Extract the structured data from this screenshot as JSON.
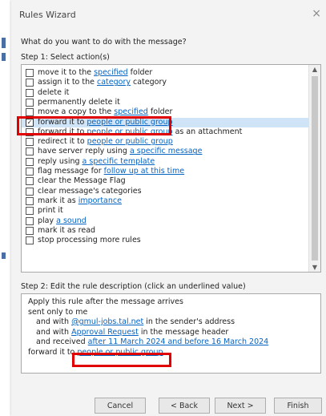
{
  "dialog": {
    "title": "Rules Wizard",
    "close_glyph": "×",
    "question": "What do you want to do with the message?",
    "step1_label": "Step 1: Select action(s)",
    "step2_label": "Step 2: Edit the rule description (click an underlined value)"
  },
  "actions": [
    {
      "checked": false,
      "before": "move it to the ",
      "link": "specified",
      "after": " folder"
    },
    {
      "checked": false,
      "before": "assign it to the ",
      "link": "category",
      "after": " category"
    },
    {
      "checked": false,
      "before": "delete it",
      "link": "",
      "after": ""
    },
    {
      "checked": false,
      "before": "permanently delete it",
      "link": "",
      "after": ""
    },
    {
      "checked": false,
      "before": "move a copy to the ",
      "link": "specified",
      "after": " folder"
    },
    {
      "checked": true,
      "before": "forward it to ",
      "link": "people or public group",
      "after": ""
    },
    {
      "checked": false,
      "before": "forward it to ",
      "link": "people or public group",
      "after": " as an attachment"
    },
    {
      "checked": false,
      "before": "redirect it to ",
      "link": "people or public group",
      "after": ""
    },
    {
      "checked": false,
      "before": "have server reply using ",
      "link": "a specific message",
      "after": ""
    },
    {
      "checked": false,
      "before": "reply using ",
      "link": "a specific template",
      "after": ""
    },
    {
      "checked": false,
      "before": "flag message for ",
      "link": "follow up at this time",
      "after": ""
    },
    {
      "checked": false,
      "before": "clear the Message Flag",
      "link": "",
      "after": ""
    },
    {
      "checked": false,
      "before": "clear message's categories",
      "link": "",
      "after": ""
    },
    {
      "checked": false,
      "before": "mark it as ",
      "link": "importance",
      "after": ""
    },
    {
      "checked": false,
      "before": "print it",
      "link": "",
      "after": ""
    },
    {
      "checked": false,
      "before": "play ",
      "link": "a sound",
      "after": ""
    },
    {
      "checked": false,
      "before": "mark it as read",
      "link": "",
      "after": ""
    },
    {
      "checked": false,
      "before": "stop processing more rules",
      "link": "",
      "after": ""
    }
  ],
  "description": [
    {
      "indent": false,
      "before": "Apply this rule after the message arrives",
      "link": "",
      "after": ""
    },
    {
      "indent": false,
      "before": "sent only to me",
      "link": "",
      "after": ""
    },
    {
      "indent": true,
      "before": "and with ",
      "link": "@gmul-jobs.tal.net",
      "after": " in the sender's address"
    },
    {
      "indent": true,
      "before": "and with ",
      "link": "Approval Request",
      "after": " in the message header"
    },
    {
      "indent": true,
      "before": "and received ",
      "link": "after 11 March 2024 and before 16 March 2024",
      "after": ""
    },
    {
      "indent": false,
      "before": "forward it to ",
      "link": "people or public group",
      "after": ""
    }
  ],
  "buttons": {
    "cancel": "Cancel",
    "back": "< Back",
    "next": "Next >",
    "finish": "Finish"
  },
  "colors": {
    "link": "#0563c1",
    "selection": "#cfe4f7",
    "highlight": "#e00000"
  }
}
